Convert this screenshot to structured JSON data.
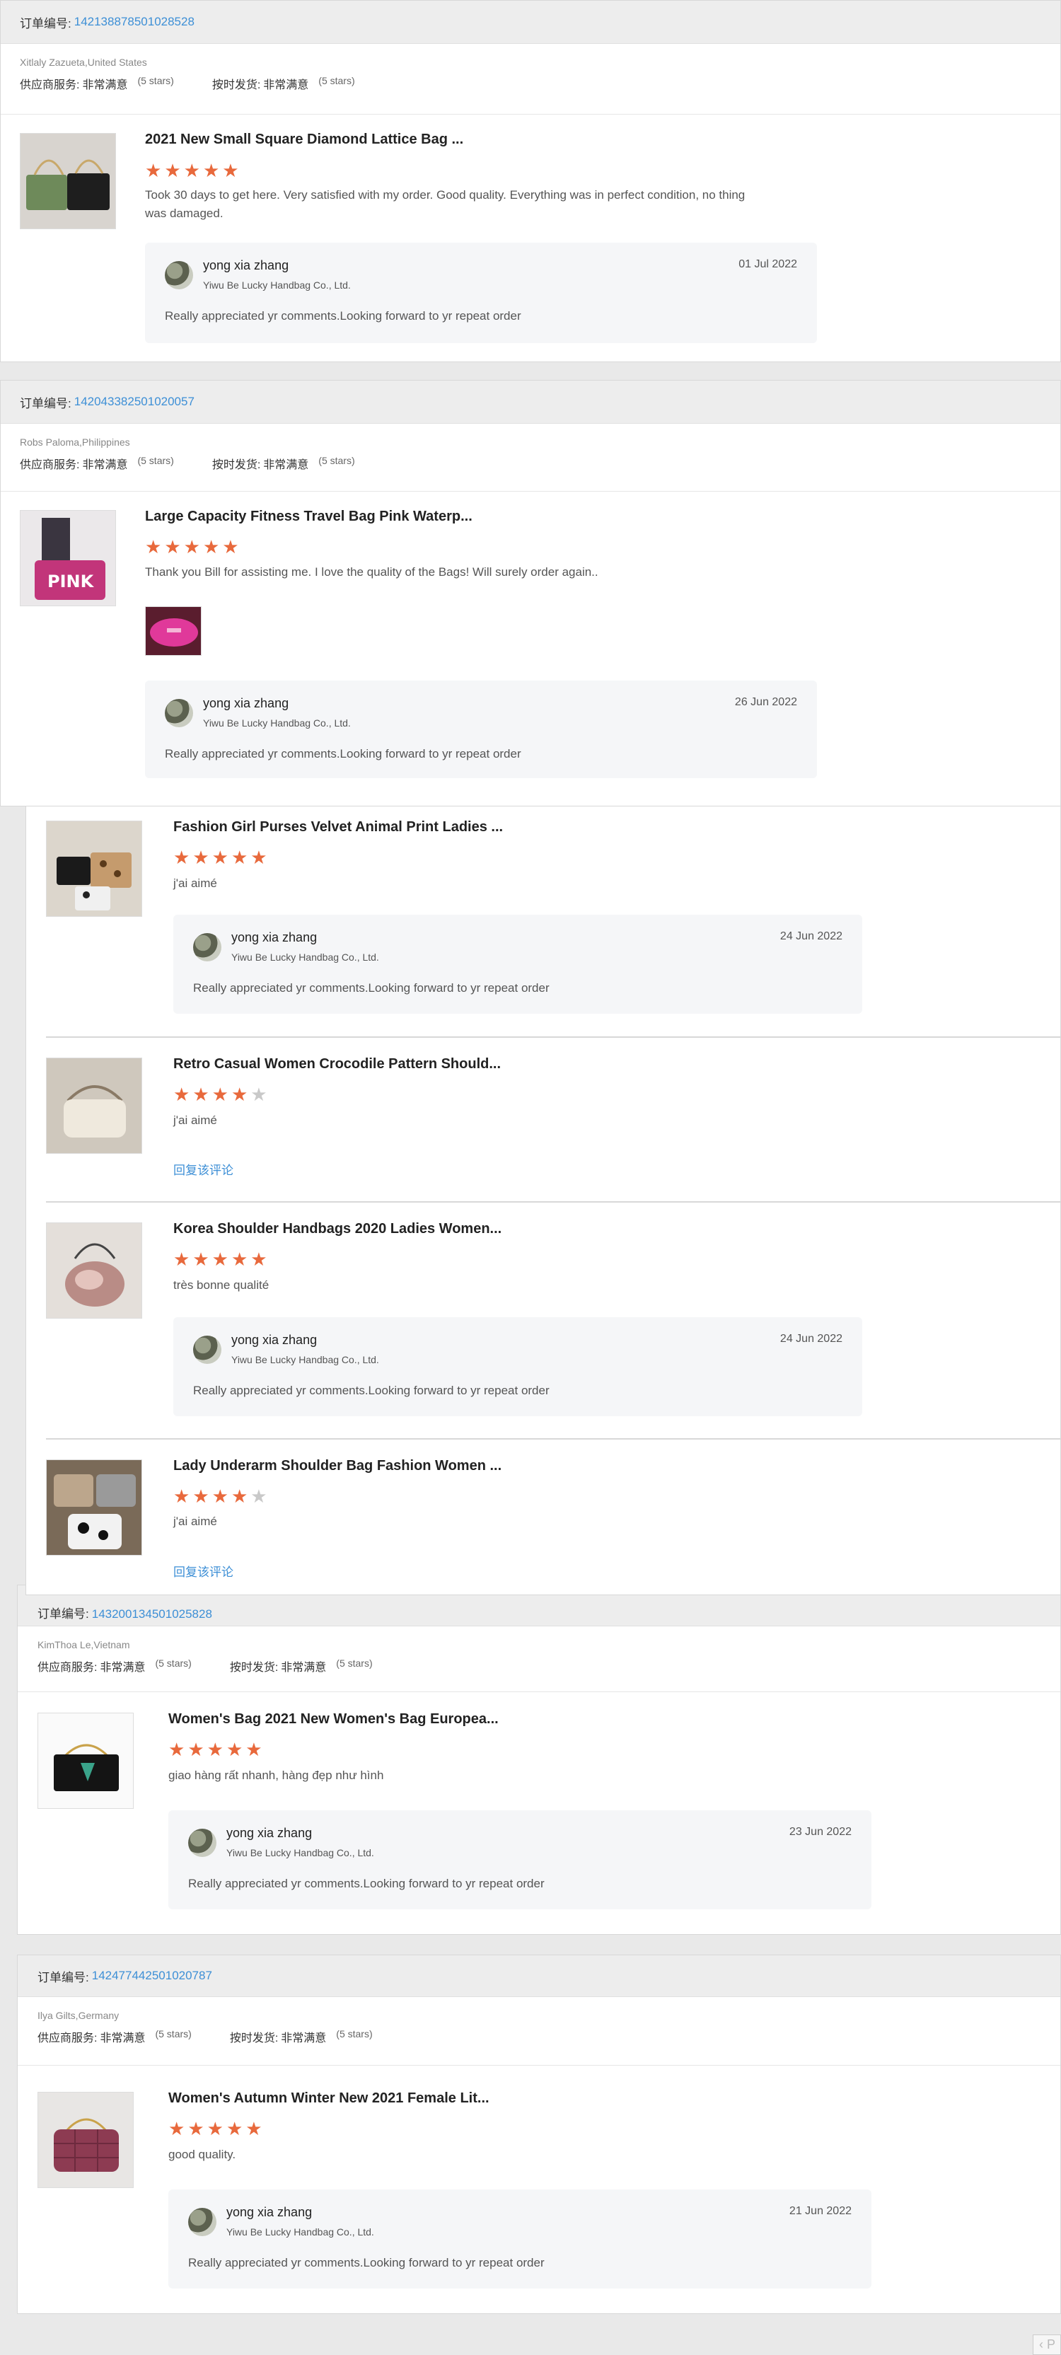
{
  "order_label": "订单编号:",
  "supplier_label": "供应商服务:",
  "shipping_label": "按时发货:",
  "rating_value": "非常满意",
  "rating_stars": "(5 stars)",
  "reply_link": "回复该评论",
  "reply_common": {
    "name": "yong xia zhang",
    "company": "Yiwu Be Lucky Handbag Co., Ltd.",
    "text": "Really appreciated yr comments.Looking forward to yr repeat order"
  },
  "orders": [
    {
      "number": "142138878501028528",
      "buyer": "Xitlaly Zazueta,United States",
      "items": [
        {
          "title": "2021 New Small Square Diamond Lattice Bag ...",
          "stars": 5,
          "comment": "Took 30 days to get here. Very satisfied with my order. Good quality. Everything was in perfect condition, no thing was damaged.",
          "reply_date": "01 Jul 2022"
        }
      ]
    },
    {
      "number": "142043382501020057",
      "buyer": "Robs Paloma,Philippines",
      "items": [
        {
          "title": "Large Capacity Fitness Travel Bag Pink Waterp...",
          "stars": 5,
          "comment": "Thank you Bill for assisting me. I love the quality of the Bags! Will surely order again..",
          "reply_date": "26 Jun 2022"
        }
      ]
    },
    {
      "number": "",
      "buyer": "",
      "items": [
        {
          "title": "Fashion Girl Purses Velvet Animal Print Ladies ...",
          "stars": 5,
          "comment": "j'ai aimé",
          "reply_date": "24 Jun 2022"
        },
        {
          "title": "Retro Casual Women Crocodile Pattern Should...",
          "stars": 4,
          "comment": "j'ai aimé"
        },
        {
          "title": "Korea Shoulder Handbags 2020 Ladies Women...",
          "stars": 5,
          "comment": "très bonne qualité",
          "reply_date": "24 Jun 2022"
        },
        {
          "title": "Lady Underarm Shoulder Bag Fashion Women ...",
          "stars": 4,
          "comment": "j'ai aimé"
        }
      ]
    },
    {
      "number": "143200134501025828",
      "buyer": "KimThoa Le,Vietnam",
      "items": [
        {
          "title": "Women's Bag 2021 New Women's Bag Europea...",
          "stars": 5,
          "comment": "giao hàng rất nhanh, hàng đẹp như hình",
          "reply_date": "23 Jun 2022"
        }
      ]
    },
    {
      "number": "142477442501020787",
      "buyer": "Ilya Gilts,Germany",
      "items": [
        {
          "title": "Women's Autumn Winter New 2021 Female Lit...",
          "stars": 5,
          "comment": "good quality.",
          "reply_date": "21 Jun 2022"
        }
      ]
    }
  ],
  "pager_prev": "‹ P"
}
